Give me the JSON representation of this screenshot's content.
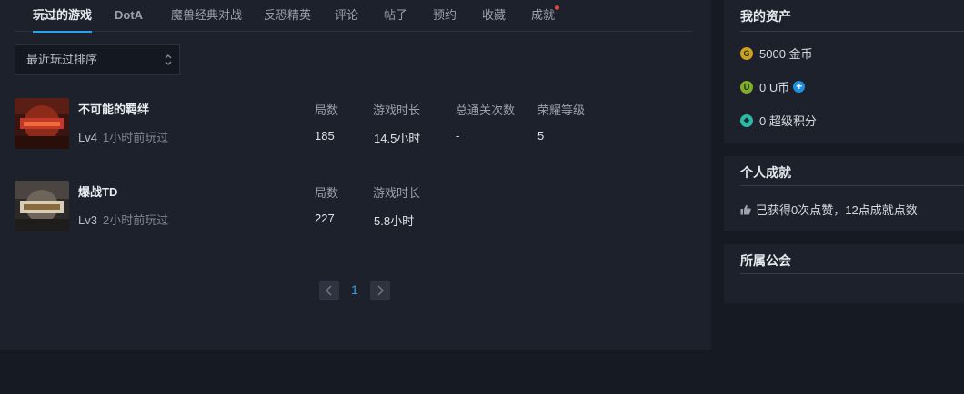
{
  "tabs": [
    {
      "label": "玩过的游戏"
    },
    {
      "label": "DotA"
    },
    {
      "label": "魔兽经典对战"
    },
    {
      "label": "反恐精英"
    },
    {
      "label": "评论"
    },
    {
      "label": "帖子"
    },
    {
      "label": "预约"
    },
    {
      "label": "收藏"
    },
    {
      "label": "成就"
    }
  ],
  "sort": {
    "selected": "最近玩过排序"
  },
  "games": [
    {
      "name": "不可能的羁绊",
      "level": "Lv4",
      "last_played": "1小时前玩过",
      "stats": [
        {
          "label": "局数",
          "value": "185"
        },
        {
          "label": "游戏时长",
          "value": "14.5小时"
        },
        {
          "label": "总通关次数",
          "value": "-"
        },
        {
          "label": "荣耀等级",
          "value": "5"
        }
      ]
    },
    {
      "name": "爆战TD",
      "level": "Lv3",
      "last_played": "2小时前玩过",
      "stats": [
        {
          "label": "局数",
          "value": "227"
        },
        {
          "label": "游戏时长",
          "value": "5.8小时"
        }
      ]
    }
  ],
  "pagination": {
    "current": "1"
  },
  "assets": {
    "title": "我的资产",
    "gold": "5000 金币",
    "ucoin": "0 U币",
    "points": "0 超级积分"
  },
  "achievements": {
    "title": "个人成就",
    "summary": "已获得0次点赞，12点成就点数"
  },
  "guild": {
    "title": "所属公会"
  },
  "colors": {
    "accent": "#2aa3ee",
    "notify_dot": "#e4483b",
    "gold_coin": "#c9a227",
    "u_coin": "#7fae2a",
    "points_coin": "#2fb8a6"
  }
}
